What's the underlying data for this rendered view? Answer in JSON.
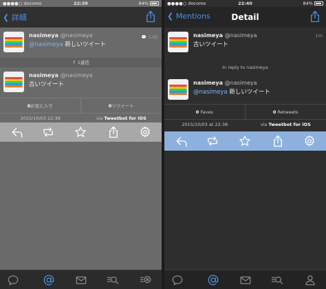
{
  "left": {
    "status": {
      "carrier": "docomo",
      "time": "22:39",
      "battery": "84%"
    },
    "nav": {
      "back": "詳細",
      "title": ""
    },
    "reply_tweet": {
      "name": "nasimeya",
      "handle": "@nasimeya",
      "mention": "@nasimeya",
      "text": "新しいツイート",
      "time": "52秒"
    },
    "reply_count": "1返信",
    "main_tweet": {
      "name": "nasimeya",
      "handle": "@nasimeya",
      "text": "古いツイート"
    },
    "stats": {
      "faves_count": "0",
      "faves_label": "お気に入り",
      "retweets_count": "0",
      "retweets_label": "リツイート"
    },
    "meta": {
      "date": "2015/10/03 22:38",
      "via_prefix": "via ",
      "client": "Tweetbot for iOS"
    }
  },
  "right": {
    "status": {
      "carrier": "docomo",
      "time": "22:40",
      "battery": "84%"
    },
    "nav": {
      "back": "Mentions",
      "title": "Detail"
    },
    "parent_tweet": {
      "name": "nasimeya",
      "handle": "@nasimeya",
      "text": "古いツイート",
      "time": "1m"
    },
    "in_reply_to": "In reply to nasimeya",
    "main_tweet": {
      "name": "nasimeya",
      "handle": "@nasimeya",
      "mention": "@nasimeya",
      "text": "新しいツイート"
    },
    "stats": {
      "faves_count": "0",
      "faves_label": "Faves",
      "retweets_count": "0",
      "retweets_label": "Retweets"
    },
    "meta": {
      "date": "2015/10/03 at 22:38",
      "via_prefix": "via ",
      "client": "Tweetbot for iOS"
    }
  },
  "colors": {
    "accent": "#4a90e2",
    "left_action_bar": "#a8a8a8",
    "right_action_bar": "#8db0de",
    "mention": "#7db3ff"
  },
  "icons": {
    "action_bar": [
      "reply-icon",
      "retweet-icon",
      "star-icon",
      "share-icon",
      "gear-icon"
    ],
    "tab_bar": [
      "timeline-icon",
      "mentions-icon",
      "messages-icon",
      "search-icon",
      "profile-icon"
    ]
  }
}
